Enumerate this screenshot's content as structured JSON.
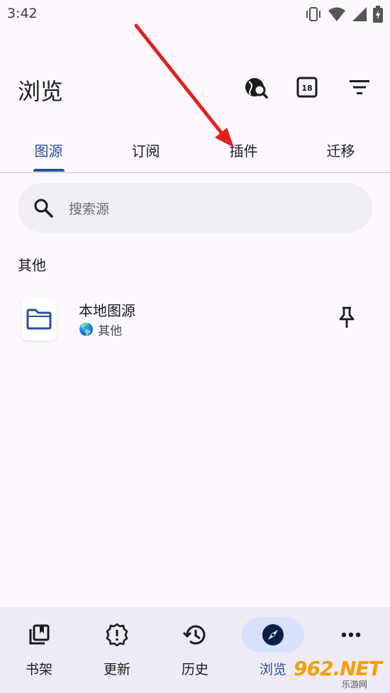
{
  "status_bar": {
    "time": "3:42"
  },
  "app_bar": {
    "title": "浏览"
  },
  "tabs": [
    {
      "label": "图源"
    },
    {
      "label": "订阅"
    },
    {
      "label": "插件"
    },
    {
      "label": "迁移"
    }
  ],
  "search": {
    "placeholder": "搜索源"
  },
  "section": {
    "title": "其他"
  },
  "sources": [
    {
      "name": "本地图源",
      "language_flag": "🌎",
      "language": "其他"
    }
  ],
  "bottom_nav": [
    {
      "label": "书架",
      "icon": "library-icon"
    },
    {
      "label": "更新",
      "icon": "updates-icon"
    },
    {
      "label": "历史",
      "icon": "history-icon"
    },
    {
      "label": "浏览",
      "icon": "compass-icon"
    },
    {
      "label": "",
      "icon": "more-icon"
    }
  ],
  "watermark": {
    "brand": "962.NET",
    "sub": "乐游网"
  },
  "colors": {
    "accent": "#28509c",
    "background": "#fcf8fd",
    "nav_background": "#efebf5",
    "arrow": "#e02020"
  }
}
